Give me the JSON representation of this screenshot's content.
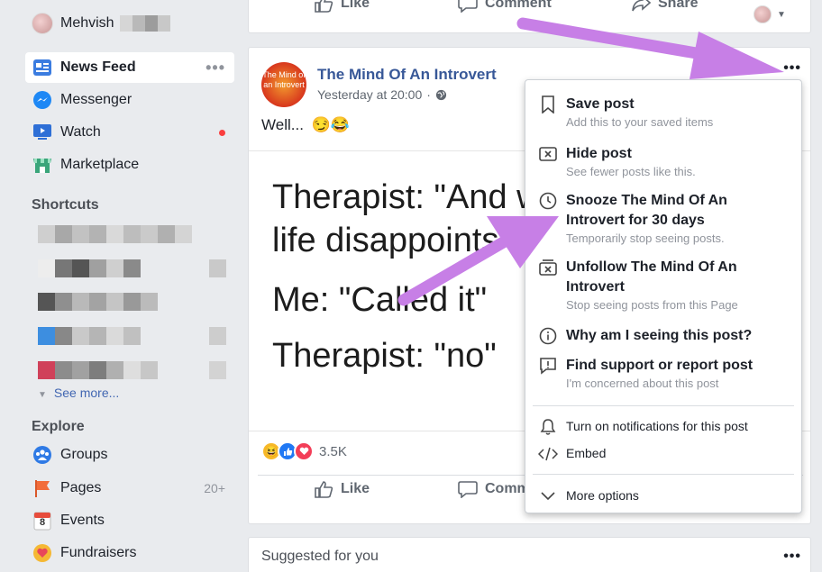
{
  "sidebar": {
    "profile_name": "Mehvish",
    "nav": [
      {
        "label": "News Feed",
        "icon": "news-feed-icon"
      },
      {
        "label": "Messenger",
        "icon": "messenger-icon"
      },
      {
        "label": "Watch",
        "icon": "watch-icon"
      },
      {
        "label": "Marketplace",
        "icon": "marketplace-icon"
      }
    ],
    "shortcuts_title": "Shortcuts",
    "see_more": "See more...",
    "explore_title": "Explore",
    "explore": [
      {
        "label": "Groups",
        "icon": "groups-icon"
      },
      {
        "label": "Pages",
        "icon": "pages-flag-icon",
        "count": "20+"
      },
      {
        "label": "Events",
        "icon": "events-calendar-icon",
        "date": "8"
      },
      {
        "label": "Fundraisers",
        "icon": "fundraisers-icon"
      }
    ]
  },
  "top_bar": {
    "like": "Like",
    "comment": "Comment",
    "share": "Share"
  },
  "post": {
    "page_name": "The Mind Of An Introvert",
    "avatar_text": "The Mind of an Introvert",
    "time": "Yesterday at 20:00",
    "separator": "·",
    "text": "Well...",
    "emoji": "😏😂",
    "meme_lines": [
      "Therapist: \"And wh",
      "life disappoints u",
      "Me: \"Called it\"",
      "Therapist: \"no\""
    ],
    "reaction_count": "3.5K",
    "like": "Like",
    "comment": "Comm"
  },
  "menu": {
    "save_title": "Save post",
    "save_sub": "Add this to your saved items",
    "hide_title": "Hide post",
    "hide_sub": "See fewer posts like this.",
    "snooze_title_1": "Snooze The Mind Of An",
    "snooze_title_2": "Introvert for 30 days",
    "snooze_sub": "Temporarily stop seeing posts.",
    "unfollow_title_1": "Unfollow The Mind Of An",
    "unfollow_title_2": "Introvert",
    "unfollow_sub": "Stop seeing posts from this Page",
    "why": "Why am I seeing this post?",
    "report_title": "Find support or report post",
    "report_sub": "I'm concerned about this post",
    "notifications": "Turn on notifications for this post",
    "embed": "Embed",
    "more": "More options"
  },
  "suggested": {
    "title": "Suggested for you"
  },
  "colors": {
    "fb_blue": "#4267b2",
    "link": "#385898",
    "arrow": "#c77fe6",
    "notify_red": "#fa3e3e"
  }
}
